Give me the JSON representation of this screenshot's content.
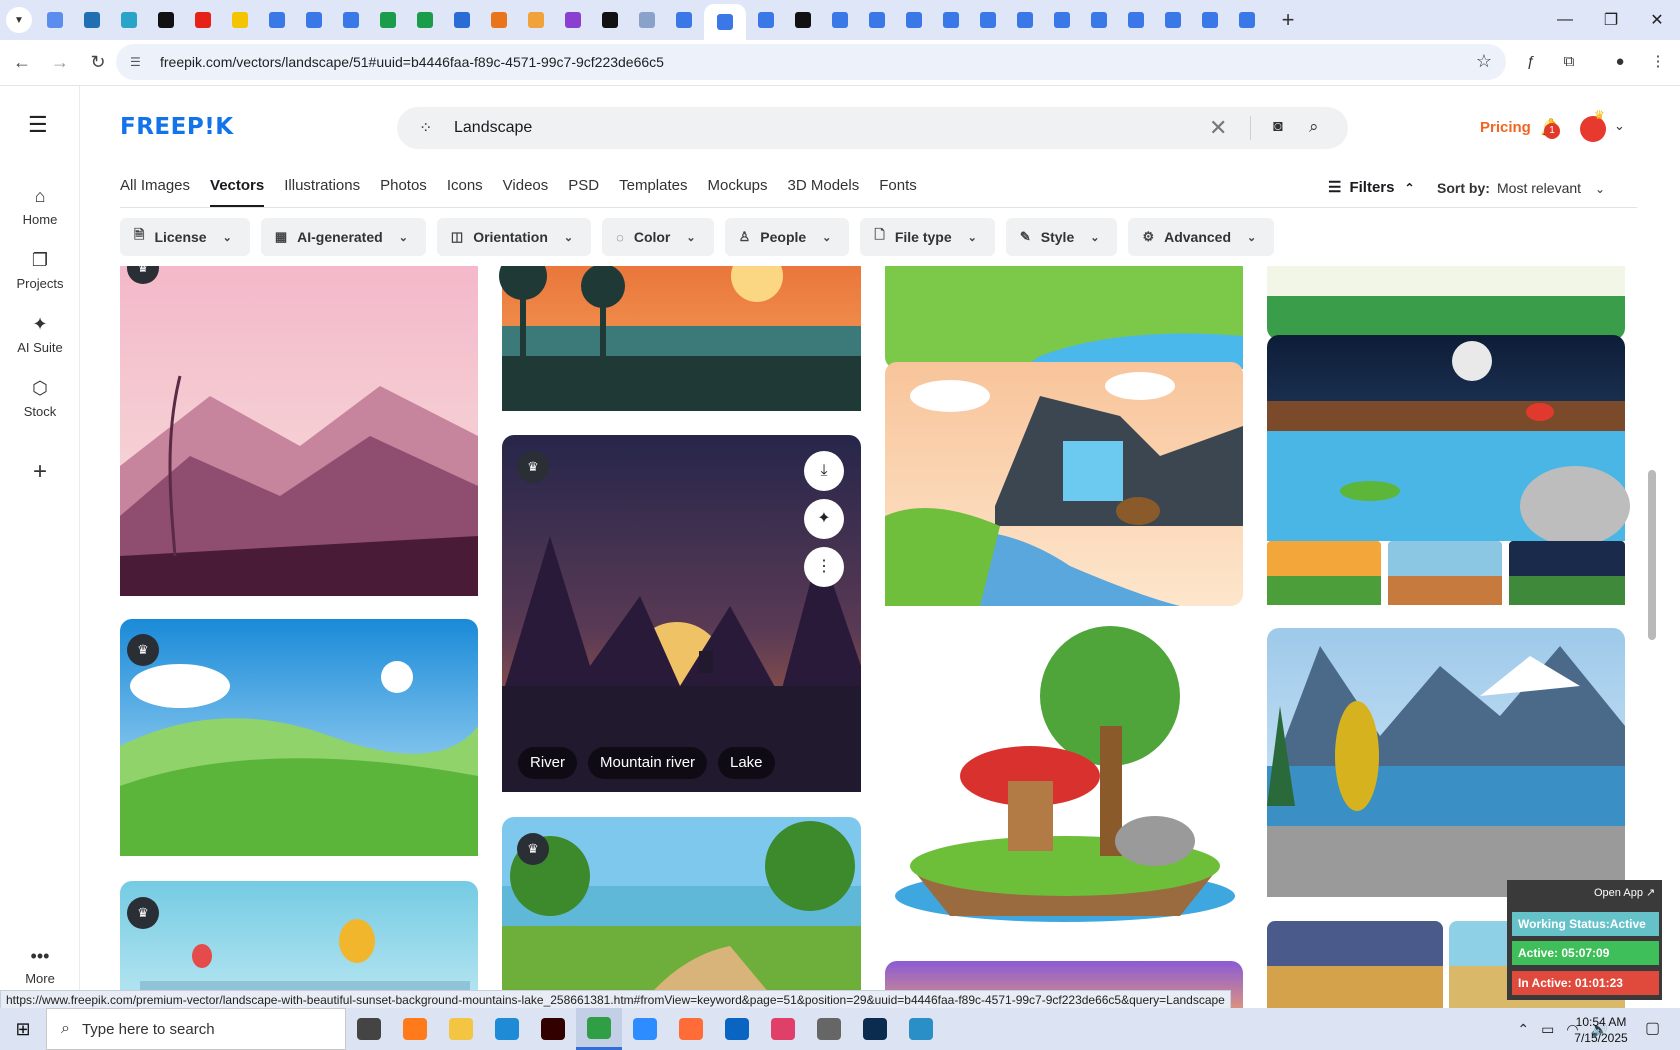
{
  "browser": {
    "tab_icons": [
      {
        "name": "tab-icon-1",
        "color": "#5b8def"
      },
      {
        "name": "tab-icon-2",
        "color": "#1f6fb2"
      },
      {
        "name": "tab-icon-3",
        "color": "#2aa3c9"
      },
      {
        "name": "tab-icon-4",
        "color": "#111111"
      },
      {
        "name": "tab-icon-5",
        "color": "#e62117"
      },
      {
        "name": "tab-icon-6",
        "color": "#f5c400"
      },
      {
        "name": "tab-icon-7",
        "color": "#3a78e7"
      },
      {
        "name": "tab-icon-8",
        "color": "#3a78e7"
      },
      {
        "name": "tab-icon-9",
        "color": "#3a78e7"
      },
      {
        "name": "tab-icon-10",
        "color": "#1a9c4b"
      },
      {
        "name": "tab-icon-11",
        "color": "#1a9c4b"
      },
      {
        "name": "tab-icon-12",
        "color": "#2b6cd4"
      },
      {
        "name": "tab-icon-13",
        "color": "#e8741c"
      },
      {
        "name": "tab-icon-14",
        "color": "#f2a23a"
      },
      {
        "name": "tab-icon-15",
        "color": "#8a3fd1"
      },
      {
        "name": "tab-icon-16",
        "color": "#111111"
      },
      {
        "name": "tab-icon-17",
        "color": "#8aa1c9"
      },
      {
        "name": "tab-icon-18",
        "color": "#3a78e7"
      },
      {
        "name": "tab-icon-19",
        "color": "#3a78e7",
        "active": true
      },
      {
        "name": "tab-icon-20",
        "color": "#3a78e7"
      },
      {
        "name": "tab-icon-21",
        "color": "#111111"
      },
      {
        "name": "tab-icon-22",
        "color": "#3a78e7"
      },
      {
        "name": "tab-icon-23",
        "color": "#3a78e7"
      },
      {
        "name": "tab-icon-24",
        "color": "#3a78e7"
      },
      {
        "name": "tab-icon-25",
        "color": "#3a78e7"
      },
      {
        "name": "tab-icon-26",
        "color": "#3a78e7"
      },
      {
        "name": "tab-icon-27",
        "color": "#3a78e7"
      },
      {
        "name": "tab-icon-28",
        "color": "#3a78e7"
      },
      {
        "name": "tab-icon-29",
        "color": "#3a78e7"
      },
      {
        "name": "tab-icon-30",
        "color": "#3a78e7"
      },
      {
        "name": "tab-icon-31",
        "color": "#3a78e7"
      },
      {
        "name": "tab-icon-32",
        "color": "#3a78e7"
      },
      {
        "name": "tab-icon-33",
        "color": "#3a78e7"
      }
    ],
    "url": "freepik.com/vectors/landscape/51#uuid=b4446faa-f89c-4571-99c7-9cf223de66c5",
    "status_url": "https://www.freepik.com/premium-vector/landscape-with-beautiful-sunset-background-mountains-lake_258661381.htm#fromView=keyword&page=51&position=29&uuid=b4446faa-f89c-4571-99c7-9cf223de66c5&query=Landscape"
  },
  "freepik": {
    "logo": "FREEP!K",
    "search_value": "Landscape",
    "pricing": "Pricing",
    "notification_count": "1",
    "sidebar": [
      {
        "label": "Home",
        "icon": "home-icon",
        "glyph": "⌂"
      },
      {
        "label": "Projects",
        "icon": "projects-icon",
        "glyph": "❐"
      },
      {
        "label": "AI Suite",
        "icon": "ai-suite-icon",
        "glyph": "✦"
      },
      {
        "label": "Stock",
        "icon": "stock-icon",
        "glyph": "⬡"
      }
    ],
    "more_label": "More",
    "category_tabs": [
      "All Images",
      "Vectors",
      "Illustrations",
      "Photos",
      "Icons",
      "Videos",
      "PSD",
      "Templates",
      "Mockups",
      "3D Models",
      "Fonts"
    ],
    "active_tab": "Vectors",
    "filters_label": "Filters",
    "sort_label": "Sort by:",
    "sort_value": "Most relevant",
    "filter_chips": [
      {
        "label": "License",
        "icon": "license-icon",
        "glyph": "🗎"
      },
      {
        "label": "AI-generated",
        "icon": "ai-generated-icon",
        "glyph": "▦"
      },
      {
        "label": "Orientation",
        "icon": "orientation-icon",
        "glyph": "◫"
      },
      {
        "label": "Color",
        "icon": "color-palette-icon",
        "glyph": "◌"
      },
      {
        "label": "People",
        "icon": "people-icon",
        "glyph": "♙"
      },
      {
        "label": "File type",
        "icon": "file-type-icon",
        "glyph": "🗋"
      },
      {
        "label": "Style",
        "icon": "style-brush-icon",
        "glyph": "✎"
      },
      {
        "label": "Advanced",
        "icon": "advanced-gear-icon",
        "glyph": "⚙"
      }
    ],
    "hovered_card_tags": [
      "River",
      "Mountain river",
      "Lake"
    ]
  },
  "work_status": {
    "open_app": "Open App ↗",
    "status": "Working Status:Active",
    "active": "Active: 05:07:09",
    "inactive": "In Active: 01:01:23",
    "status_color": "#66c2c9",
    "active_color": "#3fbf5a",
    "inactive_color": "#e04a3c"
  },
  "taskbar": {
    "search_placeholder": "Type here to search",
    "time": "10:54 AM",
    "date": "7/15/2025",
    "apps": [
      {
        "name": "task-view",
        "color": "#444"
      },
      {
        "name": "firefox",
        "color": "#ff7a1a"
      },
      {
        "name": "file-explorer",
        "color": "#f4c542"
      },
      {
        "name": "vscode",
        "color": "#1f8ad6"
      },
      {
        "name": "illustrator",
        "color": "#330000"
      },
      {
        "name": "chrome",
        "color": "#2f9e44",
        "active": true
      },
      {
        "name": "zoom",
        "color": "#2d8cff"
      },
      {
        "name": "postman",
        "color": "#ff6c37"
      },
      {
        "name": "outlook",
        "color": "#0a64c2"
      },
      {
        "name": "creative-cloud",
        "color": "#e03f6a"
      },
      {
        "name": "pen-tool",
        "color": "#666"
      },
      {
        "name": "photoshop",
        "color": "#0b2b4f"
      },
      {
        "name": "app-hex",
        "color": "#2b8fc7"
      }
    ]
  }
}
